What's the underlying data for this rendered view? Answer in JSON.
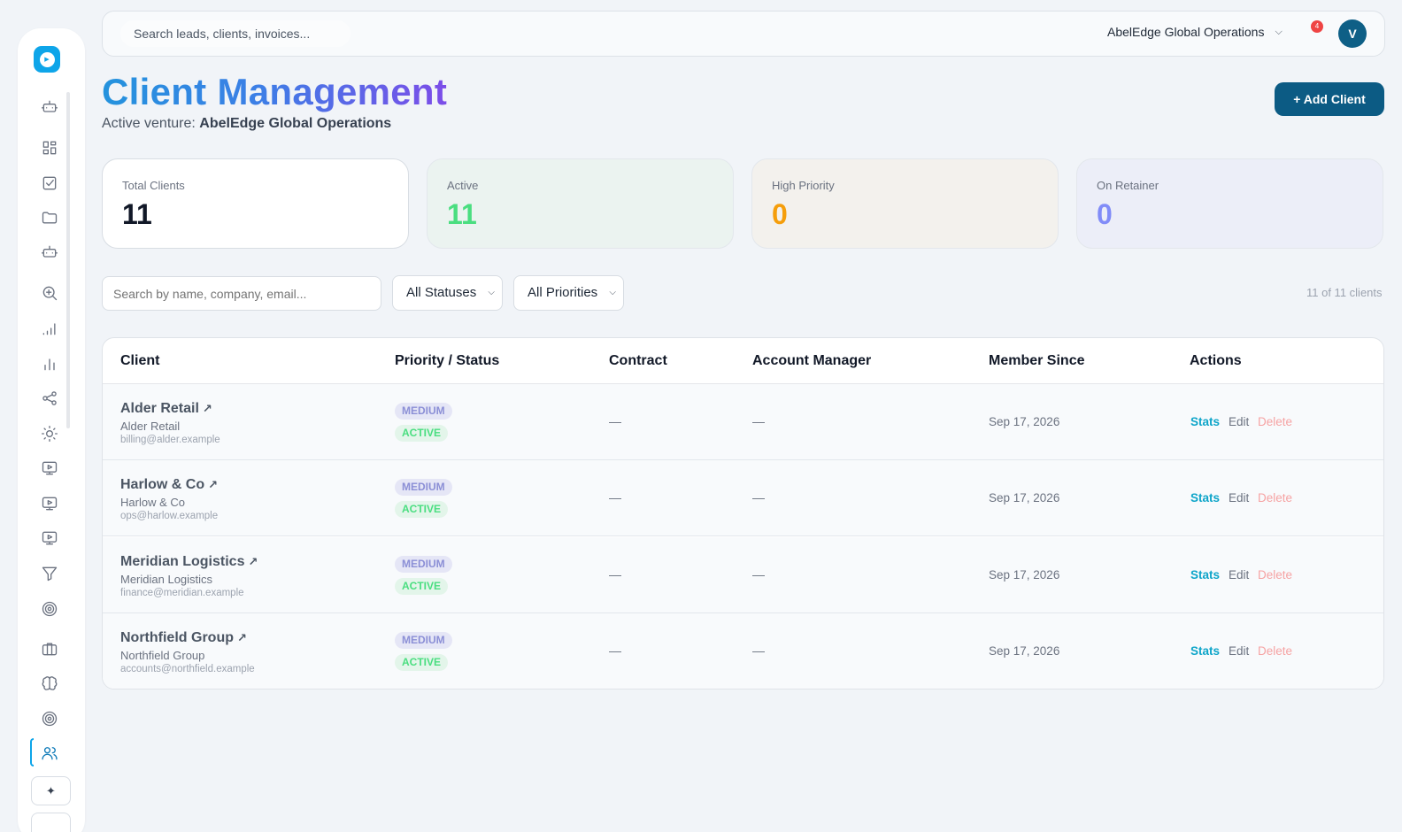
{
  "topbar": {
    "search_placeholder": "Search leads, clients, invoices...",
    "venture_name": "AbelEdge Global Operations",
    "notification_count": "4",
    "avatar_initial": "V"
  },
  "header": {
    "title": "Client Management",
    "subtitle_prefix": "Active venture:",
    "subtitle_venture": "AbelEdge Global Operations",
    "add_button": "+ Add Client"
  },
  "stats": [
    {
      "label": "Total Clients",
      "value": "11"
    },
    {
      "label": "Active",
      "value": "11"
    },
    {
      "label": "High Priority",
      "value": "0"
    },
    {
      "label": "On Retainer",
      "value": "0"
    }
  ],
  "filters": {
    "search_placeholder": "Search by name, company, email...",
    "status_select": "All Statuses",
    "priority_select": "All Priorities",
    "count_text": "11 of 11 clients"
  },
  "table": {
    "columns": [
      "Client",
      "Priority / Status",
      "Contract",
      "Account Manager",
      "Member Since",
      "Actions"
    ],
    "rows": [
      {
        "name": "Alder Retail",
        "company": "Alder Retail",
        "email": "billing@alder.example",
        "priority": "MEDIUM",
        "status": "ACTIVE",
        "contract": "—",
        "manager": "—",
        "since": "Sep 17, 2026"
      },
      {
        "name": "Harlow & Co",
        "company": "Harlow & Co",
        "email": "ops@harlow.example",
        "priority": "MEDIUM",
        "status": "ACTIVE",
        "contract": "—",
        "manager": "—",
        "since": "Sep 17, 2026"
      },
      {
        "name": "Meridian Logistics",
        "company": "Meridian Logistics",
        "email": "finance@meridian.example",
        "priority": "MEDIUM",
        "status": "ACTIVE",
        "contract": "—",
        "manager": "—",
        "since": "Sep 17, 2026"
      },
      {
        "name": "Northfield Group",
        "company": "Northfield Group",
        "email": "accounts@northfield.example",
        "priority": "MEDIUM",
        "status": "ACTIVE",
        "contract": "—",
        "manager": "—",
        "since": "Sep 17, 2026"
      }
    ],
    "actions": {
      "stats": "Stats",
      "edit": "Edit",
      "delete": "Delete"
    },
    "link_arrow": "↗"
  },
  "sidebar": {
    "icons": [
      "robot-icon",
      "dashboard-grid-icon",
      "checkbox-icon",
      "folder-icon",
      "robot-icon",
      "zoom-in-icon",
      "signal-bars-icon",
      "bar-chart-icon",
      "share-icon",
      "sun-icon",
      "monitor-play-icon",
      "monitor-play-icon",
      "monitor-play-icon",
      "funnel-icon",
      "target-icon",
      "briefcase-icon",
      "brain-icon",
      "target-icon",
      "users-icon"
    ],
    "sparkle": "✦"
  },
  "colors": {
    "accent": "#0c5b84",
    "active_green": "#4ade80",
    "high_priority": "#f59e0b",
    "retainer": "#818cf8",
    "stats_link": "#0ea5c9",
    "delete_link": "#f6a3a3"
  }
}
